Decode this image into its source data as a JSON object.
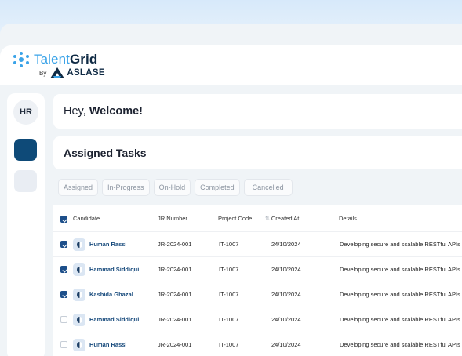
{
  "brand": {
    "name_part1": "Talent",
    "name_part2": "Grid",
    "by": "By",
    "company": "ASLASE"
  },
  "sidebar": {
    "avatar": "HR"
  },
  "welcome": {
    "greeting": "Hey,",
    "emphasis": "Welcome!"
  },
  "tasks": {
    "title": "Assigned Tasks"
  },
  "filters": [
    "Assigned",
    "In-Progress",
    "On-Hold",
    "Completed",
    "Cancelled"
  ],
  "table": {
    "columns": [
      "Candidate",
      "JR Number",
      "Project Code",
      "Created At",
      "Details"
    ],
    "rows": [
      {
        "checked": true,
        "candidate": "Human Rassi",
        "jr": "JR-2024-001",
        "project": "IT-1007",
        "created": "24/10/2024",
        "details": "Developing secure and scalable RESTful APIs i"
      },
      {
        "checked": true,
        "candidate": "Hammad Siddiqui",
        "jr": "JR-2024-001",
        "project": "IT-1007",
        "created": "24/10/2024",
        "details": "Developing secure and scalable RESTful APIs i"
      },
      {
        "checked": true,
        "candidate": "Kashida Ghazal",
        "jr": "JR-2024-001",
        "project": "IT-1007",
        "created": "24/10/2024",
        "details": "Developing secure and scalable RESTful APIs i"
      },
      {
        "checked": false,
        "candidate": "Hammad Siddiqui",
        "jr": "JR-2024-001",
        "project": "IT-1007",
        "created": "24/10/2024",
        "details": "Developing secure and scalable RESTful APIs i"
      },
      {
        "checked": false,
        "candidate": "Human Rassi",
        "jr": "JR-2024-001",
        "project": "IT-1007",
        "created": "24/10/2024",
        "details": "Developing secure and scalable RESTful APIs i"
      }
    ]
  },
  "colors": {
    "accent": "#3aa3e8",
    "brand_dark": "#0f2a44",
    "primary": "#0e4a78",
    "checkbox": "#1d4f8a"
  }
}
